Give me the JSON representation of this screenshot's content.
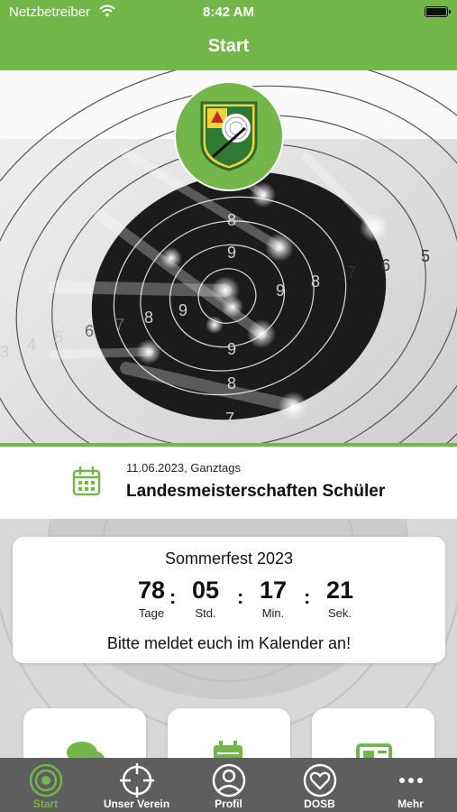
{
  "status_bar": {
    "carrier": "Netzbetreiber",
    "time": "8:42 AM"
  },
  "nav": {
    "title": "Start"
  },
  "hero": {
    "target_rings": [
      "3",
      "4",
      "5",
      "6",
      "7",
      "8",
      "9",
      "8",
      "9",
      "8",
      "7",
      "6",
      "5",
      "8",
      "9",
      "9",
      "8",
      "7"
    ]
  },
  "event": {
    "date": "11.06.2023, Ganztags",
    "title": "Landesmeisterschaften Schüler"
  },
  "countdown": {
    "title": "Sommerfest 2023",
    "units": [
      {
        "value": "78",
        "label": "Tage"
      },
      {
        "value": "05",
        "label": "Std."
      },
      {
        "value": "17",
        "label": "Min."
      },
      {
        "value": "21",
        "label": "Sek."
      }
    ],
    "separator": ":",
    "note": "Bitte meldet euch im Kalender an!"
  },
  "tiles": [
    {
      "icon": "chat-bubbles-icon"
    },
    {
      "icon": "calendar-icon"
    },
    {
      "icon": "news-icon"
    }
  ],
  "tab_bar": {
    "tabs": [
      {
        "label": "Start",
        "icon": "target-rings-icon",
        "active": true
      },
      {
        "label": "Unser Verein",
        "icon": "crosshair-icon",
        "active": false
      },
      {
        "label": "Profil",
        "icon": "person-icon",
        "active": false
      },
      {
        "label": "DOSB",
        "icon": "heart-icon",
        "active": false
      },
      {
        "label": "Mehr",
        "icon": "more-dots-icon",
        "active": false
      }
    ]
  },
  "colors": {
    "brand_green": "#73b64a",
    "tab_bar_bg": "#5e5e5e"
  }
}
